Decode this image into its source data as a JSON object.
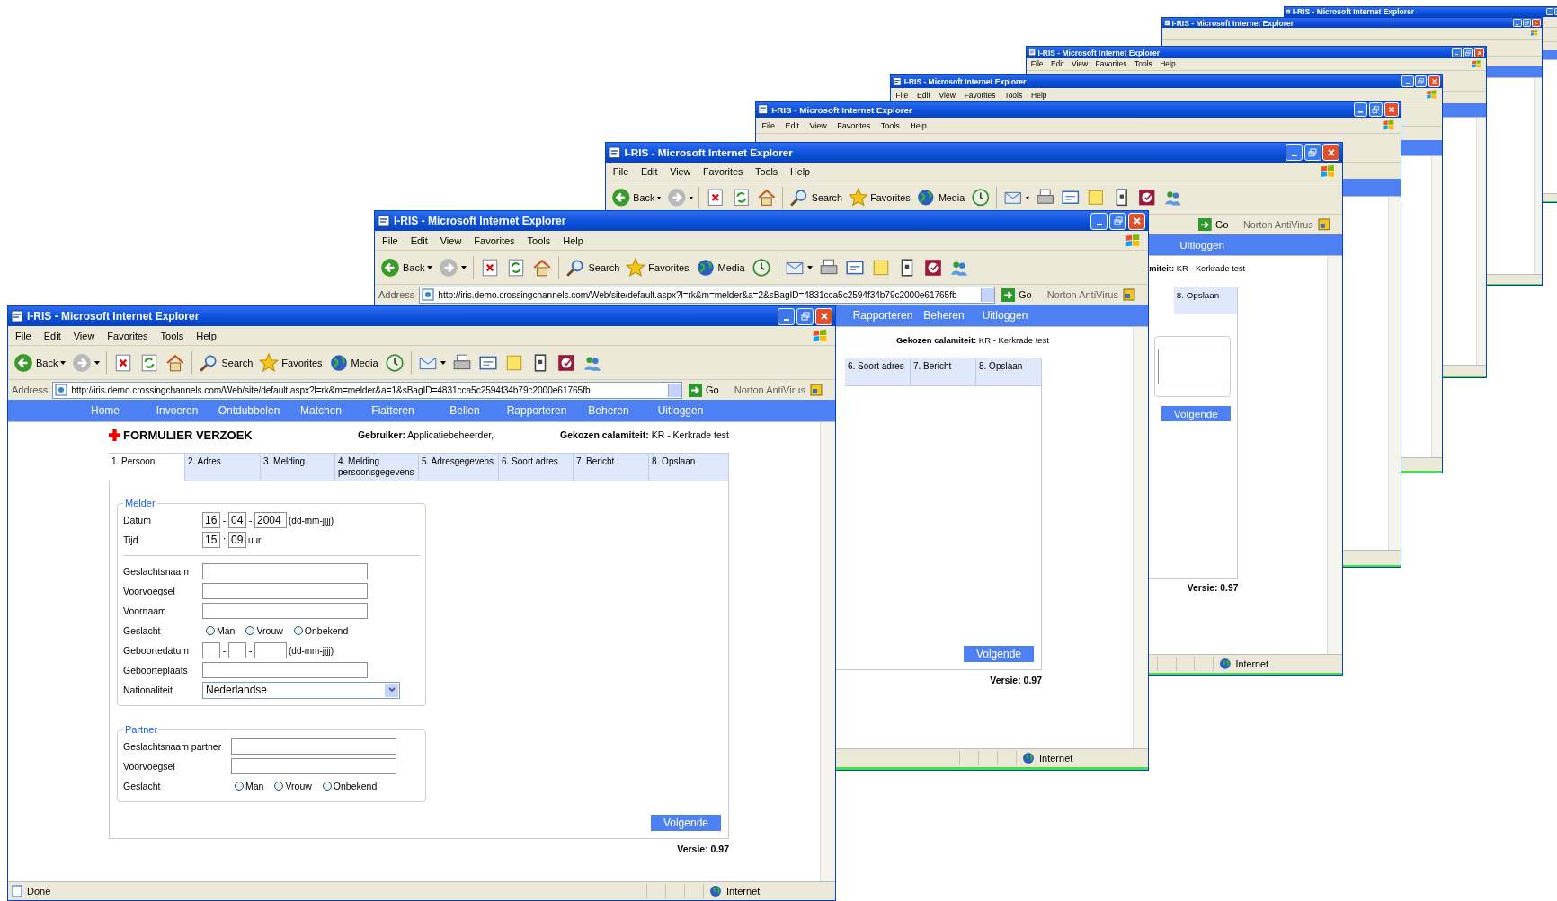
{
  "windows": [
    {
      "title": "I-RIS - Microsoft Internet Explorer",
      "menu": [
        "File",
        "Edit",
        "View",
        "Favorites",
        "Tools",
        "Help"
      ],
      "toolbar": [
        {
          "kind": "back",
          "label": "Back",
          "dropdown": true
        },
        {
          "kind": "forward",
          "dropdown": true
        },
        {
          "kind": "separator"
        },
        {
          "kind": "stop"
        },
        {
          "kind": "refresh"
        },
        {
          "kind": "home"
        },
        {
          "kind": "separator"
        },
        {
          "kind": "search",
          "label": "Search"
        },
        {
          "kind": "favorites",
          "label": "Favorites"
        },
        {
          "kind": "media",
          "label": "Media"
        },
        {
          "kind": "history"
        },
        {
          "kind": "separator"
        },
        {
          "kind": "mail",
          "dropdown": true
        },
        {
          "kind": "print"
        },
        {
          "kind": "edit"
        },
        {
          "kind": "note"
        },
        {
          "kind": "device"
        },
        {
          "kind": "target"
        },
        {
          "kind": "people"
        }
      ],
      "address": {
        "label": "Address",
        "url": "http://iris.demo.crossingchannels.com/Web/site/default.aspx?l=rk&m=melder&a=1&sBagID=4831cca5c2594f34b79c2000e61765fb",
        "go": "Go",
        "norton": "Norton AntiVirus"
      },
      "nav": [
        "Home",
        "Invoeren",
        "Ontdubbelen",
        "Matchen",
        "Fiatteren",
        "Bellen",
        "Rapporteren",
        "Beheren",
        "Uitloggen"
      ],
      "page": {
        "title": "FORMULIER VERZOEK",
        "user": "**Gebruiker:** Applicatiebeheerder,",
        "calamity": "**Gekozen calamiteit:** KR - Kerkrade test",
        "tabs": [
          {
            "label": "1. Persoon",
            "selected": true
          },
          {
            "label": "2. Adres",
            "selected": false
          },
          {
            "label": "3. Melding",
            "selected": false
          },
          {
            "label": "4. Melding persoonsgegevens",
            "selected": false
          },
          {
            "label": "5. Adresgegevens",
            "selected": false
          },
          {
            "label": "6. Soort adres",
            "selected": false
          },
          {
            "label": "7. Bericht",
            "selected": false
          },
          {
            "label": "8. Opslaan",
            "selected": false
          }
        ],
        "sections": [
          {
            "legend": "Melder",
            "rows": [
              {
                "kind": "date",
                "label": "Datum",
                "values": [
                  "16",
                  "04",
                  "2004"
                ],
                "separator": "-",
                "hint": "(dd-mm-jjjj)"
              },
              {
                "kind": "time",
                "label": "Tijd",
                "values": [
                  "15",
                  "09"
                ],
                "separator": ":",
                "unit": "uur"
              },
              {
                "kind": "divider"
              },
              {
                "kind": "text",
                "label": "Geslachtsnaam"
              },
              {
                "kind": "text",
                "label": "Voorvoegsel"
              },
              {
                "kind": "text",
                "label": "Voornaam"
              },
              {
                "kind": "radio",
                "label": "Geslacht",
                "options": [
                  {
                    "label": "Man",
                    "selected": false
                  },
                  {
                    "label": "Vrouw",
                    "selected": false
                  },
                  {
                    "label": "Onbekend",
                    "selected": false
                  }
                ]
              },
              {
                "kind": "date",
                "label": "Geboortedatum",
                "separator": "-",
                "hint": "(dd-mm-jjjj)"
              },
              {
                "kind": "text",
                "label": "Geboorteplaats"
              },
              {
                "kind": "select",
                "label": "Nationaliteit",
                "value": "Nederlandse"
              }
            ]
          },
          {
            "legend": "Partner",
            "rows": [
              {
                "kind": "text",
                "label": "Geslachtsnaam partner"
              },
              {
                "kind": "text",
                "label": "Voorvoegsel"
              },
              {
                "kind": "radio",
                "label": "Geslacht",
                "options": [
                  {
                    "label": "Man",
                    "selected": false
                  },
                  {
                    "label": "Vrouw",
                    "selected": false
                  },
                  {
                    "label": "Onbekend",
                    "selected": false
                  }
                ]
              }
            ]
          }
        ],
        "button": "Volgende",
        "version": "Versie: 0.97"
      },
      "status": {
        "text": "Done",
        "zone": "Internet"
      }
    },
    {
      "title": "I-RIS - Microsoft Internet Explorer",
      "menu": [
        "File",
        "Edit",
        "View",
        "Favorites",
        "Tools",
        "Help"
      ],
      "toolbar": [
        {
          "kind": "back",
          "label": "Back",
          "dropdown": true
        },
        {
          "kind": "forward",
          "dropdown": true
        },
        {
          "kind": "separator"
        },
        {
          "kind": "stop"
        },
        {
          "kind": "refresh"
        },
        {
          "kind": "home"
        },
        {
          "kind": "separator"
        },
        {
          "kind": "search",
          "label": "Search"
        },
        {
          "kind": "favorites",
          "label": "Favorites"
        },
        {
          "kind": "media",
          "label": "Media"
        },
        {
          "kind": "history"
        },
        {
          "kind": "separator"
        },
        {
          "kind": "mail",
          "dropdown": true
        },
        {
          "kind": "print"
        },
        {
          "kind": "edit"
        },
        {
          "kind": "note"
        },
        {
          "kind": "device"
        },
        {
          "kind": "target"
        },
        {
          "kind": "people"
        }
      ],
      "address": {
        "label": "Address",
        "url": "http://iris.demo.crossingchannels.com/Web/site/default.aspx?l=rk&m=melder&a=2&sBagID=4831cca5c2594f34b79c2000e61765fb",
        "go": "Go",
        "norton": "Norton AntiVirus"
      },
      "nav": [
        "Rapporteren",
        "Beheren",
        "Uitloggen"
      ],
      "content": {
        "calamity": "**Gekozen calamiteit:** KR - Kerkrade test",
        "tabs": [
          {
            "label": "6. Soort adres",
            "selected": false
          },
          {
            "label": "7. Bericht",
            "selected": false
          },
          {
            "label": "8. Opslaan",
            "selected": false
          }
        ],
        "button": "Volgende",
        "version": "Versie: 0.97"
      },
      "status": {
        "zone": "Internet"
      }
    },
    {
      "title": "I-RIS - Microsoft Internet Explorer",
      "menu": [
        "File",
        "Edit",
        "View",
        "Favorites",
        "Tools",
        "Help"
      ],
      "toolbar": [
        {
          "kind": "back",
          "label": "Back",
          "dropdown": true
        },
        {
          "kind": "forward",
          "dropdown": true
        },
        {
          "kind": "separator"
        },
        {
          "kind": "stop"
        },
        {
          "kind": "refresh"
        },
        {
          "kind": "home"
        },
        {
          "kind": "separator"
        },
        {
          "kind": "search",
          "label": "Search"
        },
        {
          "kind": "favorites",
          "label": "Favorites"
        },
        {
          "kind": "media",
          "label": "Media"
        },
        {
          "kind": "history"
        },
        {
          "kind": "separator"
        },
        {
          "kind": "mail",
          "dropdown": true
        },
        {
          "kind": "print"
        },
        {
          "kind": "edit"
        },
        {
          "kind": "note"
        },
        {
          "kind": "device"
        },
        {
          "kind": "target"
        },
        {
          "kind": "people"
        }
      ],
      "address": {
        "go": "Go",
        "norton": "Norton AntiVirus"
      },
      "nav": [
        "Uitloggen"
      ],
      "content": {
        "calamity": "**miteit:** KR - Kerkrade test",
        "tabs": [
          {
            "label": "8. Opslaan",
            "selected": false
          }
        ],
        "textarea": true,
        "button": "Volgende",
        "version": "Versie: 0.97"
      },
      "status": {
        "zone": "Internet"
      }
    },
    {
      "title": "I-RIS - Microsoft Internet Explorer",
      "menu": [
        "File",
        "Edit",
        "View",
        "Favorites",
        "Tools",
        "Help"
      ]
    },
    {
      "title": "I-RIS - Microsoft Internet Explorer",
      "menu": [
        "File",
        "Edit",
        "View",
        "Favorites",
        "Tools",
        "Help"
      ]
    },
    {
      "title": "I-RIS - Microsoft Internet Explorer",
      "menu": [
        "File",
        "Edit",
        "View",
        "Favorites",
        "Tools",
        "Help"
      ]
    },
    {
      "title": "I-RIS - Microsoft Internet Explorer"
    },
    {
      "title": "I-RIS - Microsoft Internet Explorer"
    }
  ]
}
